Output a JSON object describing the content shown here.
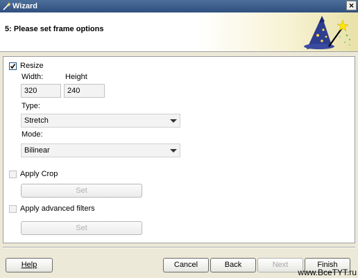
{
  "window": {
    "title": "Wizard",
    "close_glyph": "×"
  },
  "header": {
    "step_title": "5: Please set frame options",
    "logo_icon": "wizard-hat-wand-icon"
  },
  "resize": {
    "label": "Resize",
    "checked": true,
    "width_label": "Width:",
    "height_label": "Height",
    "width_value": "320",
    "height_value": "240",
    "type_label": "Type:",
    "type_value": "Stretch",
    "mode_label": "Mode:",
    "mode_value": "Bilinear"
  },
  "crop": {
    "label": "Apply Crop",
    "checked": false,
    "set_label": "Set"
  },
  "advanced": {
    "label": "Apply advanced filters",
    "checked": false,
    "set_label": "Set"
  },
  "footer": {
    "help_label": "Help",
    "cancel_label": "Cancel",
    "back_label": "Back",
    "next_label": "Next",
    "finish_label": "Finish"
  },
  "watermark": "www.BceTYT.ru",
  "colors": {
    "titlebar": "#3b5a88",
    "panel": "#ffffff",
    "dialog": "#ece9d8"
  }
}
